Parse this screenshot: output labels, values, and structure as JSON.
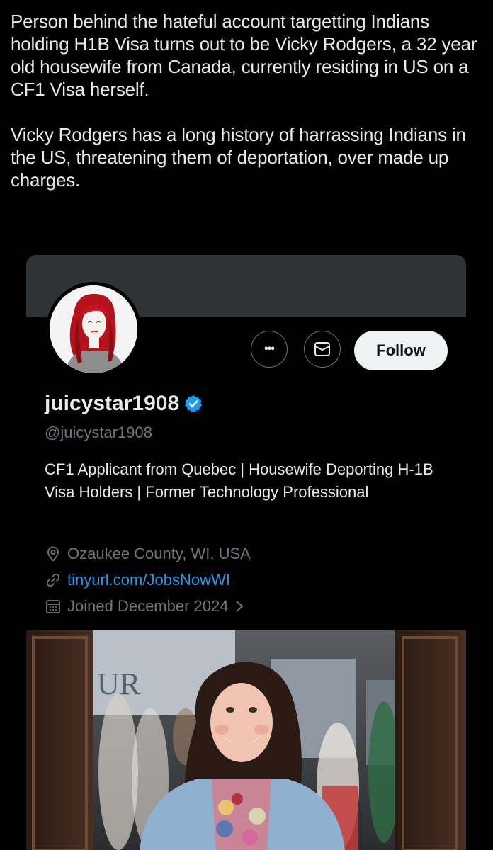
{
  "post": {
    "paragraph_1": "Person behind the hateful account targetting Indians holding H1B Visa turns out to be Vicky Rodgers, a 32 year old housewife from Canada, currently residing in US on a CF1 Visa herself.",
    "paragraph_2": "Vicky Rodgers has a long history of harrassing Indians in the US, threatening them of deportation, over made up charges."
  },
  "profile": {
    "display_name": "juicystar1908",
    "verified_icon": "verified-badge-icon",
    "handle": "@juicystar1908",
    "bio": "CF1 Applicant from Quebec | Housewife Deporting H-1B Visa Holders | Former Technology Professional",
    "location": "Ozaukee County, WI, USA",
    "link": "tinyurl.com/JobsNowWI",
    "joined": "Joined December 2024",
    "follow_label": "Follow",
    "more_label": "•••",
    "message_icon": "envelope-icon"
  },
  "photo_sign": "UR",
  "colors": {
    "background": "#000000",
    "text": "#e7e9ea",
    "secondary": "#71767b",
    "link": "#1d9bf0",
    "banner": "#2f3336",
    "follow_bg": "#eff3f4"
  }
}
